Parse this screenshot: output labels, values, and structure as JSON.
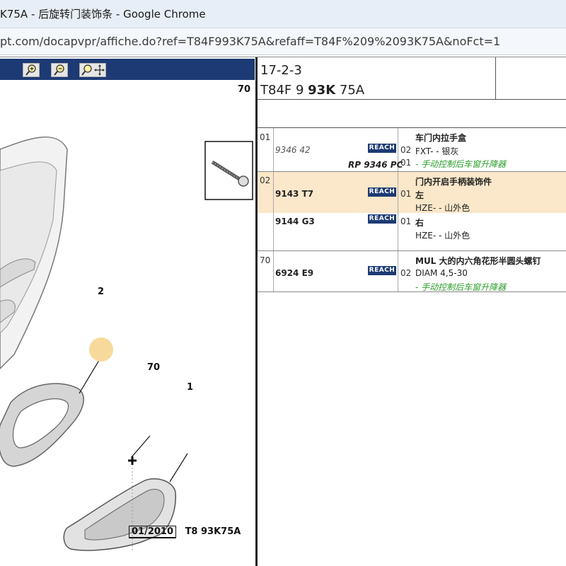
{
  "window": {
    "title": "K75A - 后旋转门装饰条 - Google Chrome",
    "url": "pt.com/docapvpr/affiche.do?ref=T84F993K75A&refaff=T84F%209%2093K75A&noFct=1"
  },
  "header": {
    "ref": "17-2-3",
    "code_prefix": "T84F 9 ",
    "code_bold": "93K",
    "code_suffix": " 75A"
  },
  "reach_label": "REACH",
  "rows": [
    {
      "num": "01",
      "part": "9346 42",
      "rp": "RP 9346 PC",
      "qtys": [
        "02",
        "01"
      ],
      "desc": [
        "车门内拉手盒",
        "FXT- - 银灰",
        "- 手动控制后车窗升降器"
      ]
    },
    {
      "num": "02",
      "part": "9143 T7",
      "qty": "01",
      "desc": [
        "门内开启手柄装饰件",
        "左",
        "HZE- - 山外色"
      ],
      "highlight": true
    },
    {
      "num": "",
      "part": "9144 G3",
      "qty": "01",
      "desc": [
        "右",
        "HZE- - 山外色"
      ]
    },
    {
      "num": "70",
      "part": "6924 E9",
      "qty": "02",
      "desc": [
        "MUL 大的内六角花形半圆头螺钉",
        "DIAM 4,5-30",
        "- 手动控制后车窗升降器"
      ]
    }
  ],
  "drawing": {
    "inset_label": "70",
    "callout_2": "2",
    "callout_70": "70",
    "callout_1": "1",
    "footer_date": "01/2010",
    "footer_code": "T8 93K75A"
  },
  "toolbar": {
    "zoom_in": "zoom-in-icon",
    "zoom_out": "zoom-out-icon",
    "zoom_pan": "zoom-pan-icon"
  }
}
